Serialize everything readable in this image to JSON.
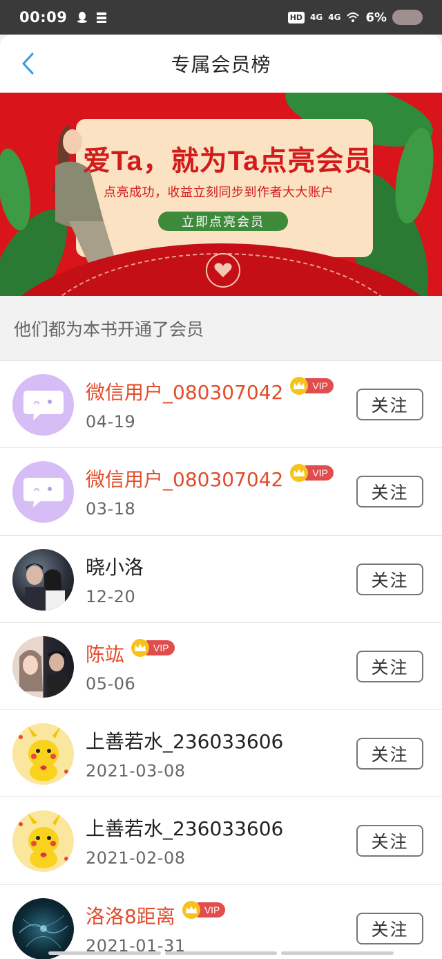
{
  "status_bar": {
    "time": "00:09",
    "network_hd": "HD",
    "signal_1": "4G",
    "signal_2": "4G",
    "battery": "6%"
  },
  "header": {
    "title": "专属会员榜"
  },
  "banner": {
    "headline": "爱Ta，就为Ta点亮会员",
    "subline": "点亮成功，收益立刻同步到作者大大账户",
    "cta_label": "立即点亮会员"
  },
  "section": {
    "title": "他们都为本书开通了会员"
  },
  "vip_label": "VIP",
  "follow_label": "关注",
  "members": [
    {
      "name": "微信用户_080307042",
      "date": "04-19",
      "vip": true,
      "avatar": "wechat-default"
    },
    {
      "name": "微信用户_080307042",
      "date": "03-18",
      "vip": true,
      "avatar": "wechat-default"
    },
    {
      "name": "晓小洛",
      "date": "12-20",
      "vip": false,
      "avatar": "couple-photo"
    },
    {
      "name": "陈竑",
      "date": "05-06",
      "vip": true,
      "avatar": "couple-photo-2"
    },
    {
      "name": "上善若水_236033606",
      "date": "2021-03-08",
      "vip": false,
      "avatar": "pikachu"
    },
    {
      "name": "上善若水_236033606",
      "date": "2021-02-08",
      "vip": false,
      "avatar": "pikachu"
    },
    {
      "name": "洛洛8距离",
      "date": "2021-01-31",
      "vip": true,
      "avatar": "space"
    }
  ],
  "colors": {
    "vip_name": "#e14c2a",
    "banner_red": "#d9141b",
    "cta_green": "#3c8a3a",
    "back_arrow": "#2a9be8"
  }
}
